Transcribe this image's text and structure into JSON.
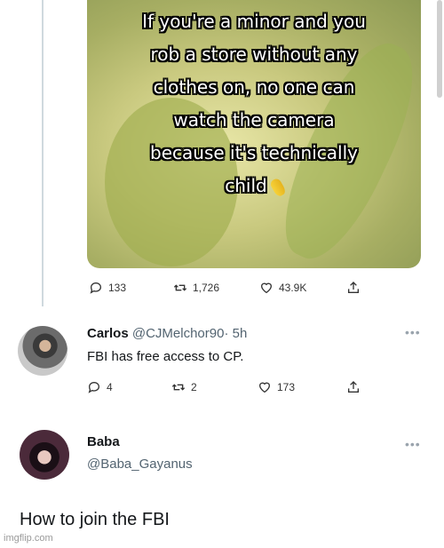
{
  "meme": {
    "lines": [
      "If you're a minor and you",
      "rob a store without any",
      "clothes on, no one can",
      "watch the camera",
      "because it's technically",
      "child"
    ]
  },
  "tweet1": {
    "replies": "133",
    "retweets": "1,726",
    "likes": "43.9K"
  },
  "tweet2": {
    "name": "Carlos",
    "handle": "@CJMelchor90",
    "time": "· 5h",
    "text": "FBI has free access to CP.",
    "replies": "4",
    "retweets": "2",
    "likes": "173"
  },
  "tweet3": {
    "name": "Baba",
    "handle": "@Baba_Gayanus",
    "text": "How to join the FBI"
  },
  "watermark": "imgflip.com",
  "icons": {
    "reply": "reply-icon",
    "retweet": "retweet-icon",
    "like": "heart-icon",
    "share": "share-icon",
    "more": "more-dots-icon"
  }
}
